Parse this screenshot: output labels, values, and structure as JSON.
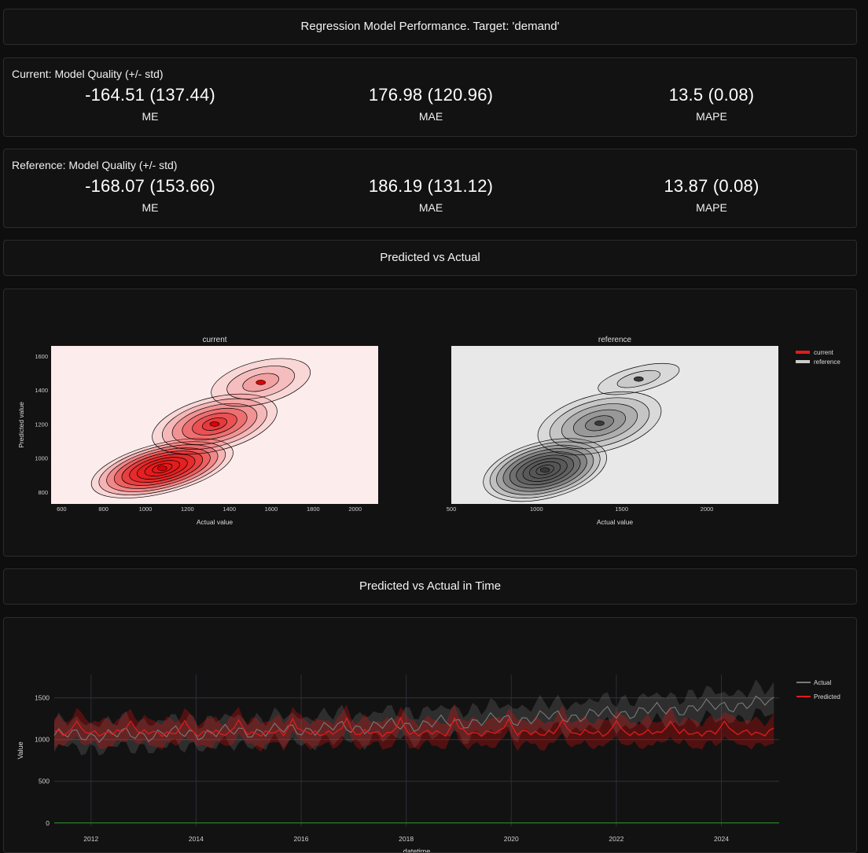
{
  "header": {
    "title": "Regression Model Performance. Target: 'demand'"
  },
  "current_quality": {
    "caption": "Current: Model Quality (+/- std)",
    "metrics": [
      {
        "value": "-164.51 (137.44)",
        "label": "ME"
      },
      {
        "value": "176.98 (120.96)",
        "label": "MAE"
      },
      {
        "value": "13.5 (0.08)",
        "label": "MAPE"
      }
    ]
  },
  "reference_quality": {
    "caption": "Reference: Model Quality (+/- std)",
    "metrics": [
      {
        "value": "-168.07 (153.66)",
        "label": "ME"
      },
      {
        "value": "186.19 (131.12)",
        "label": "MAE"
      },
      {
        "value": "13.87 (0.08)",
        "label": "MAPE"
      }
    ]
  },
  "pred_vs_actual_section": {
    "title": "Predicted vs Actual"
  },
  "pred_vs_actual_in_time_section": {
    "title": "Predicted vs Actual in Time"
  },
  "colors": {
    "current_fill": "#e31a1c",
    "current_bg": "#fdecec",
    "reference_fill": "#555555",
    "reference_bg": "#e8e8e8",
    "actual_line": "#7a7a7a",
    "predicted_line": "#e11b1b",
    "zero_line": "#2ca02c"
  },
  "chart_data": [
    {
      "type": "heatmap",
      "subtype": "2d density contour",
      "titles": [
        "current",
        "reference"
      ],
      "xlabel": "Actual value",
      "ylabel": "Predicted value",
      "legend": {
        "entries": [
          "current",
          "reference"
        ],
        "placement": "top-right"
      },
      "panels": [
        {
          "name": "current",
          "xlim": [
            550,
            2110
          ],
          "ylim": [
            730,
            1660
          ],
          "xticks": [
            600,
            800,
            1000,
            1200,
            1400,
            1600,
            1800,
            2000
          ],
          "yticks": [
            800,
            1000,
            1200,
            1400,
            1600
          ],
          "density_peaks": [
            {
              "x": 1080,
              "y": 940,
              "sx": 160,
              "sy": 65,
              "weight": 1.0
            },
            {
              "x": 1330,
              "y": 1200,
              "sx": 140,
              "sy": 70,
              "weight": 0.7
            },
            {
              "x": 1550,
              "y": 1445,
              "sx": 110,
              "sy": 55,
              "weight": 0.35
            }
          ]
        },
        {
          "name": "reference",
          "xlim": [
            500,
            2420
          ],
          "ylim": [
            730,
            1660
          ],
          "xticks": [
            500,
            1000,
            1500,
            2000
          ],
          "yticks": [
            800,
            1000,
            1200,
            1400,
            1600
          ],
          "density_peaks": [
            {
              "x": 1050,
              "y": 930,
              "sx": 170,
              "sy": 75,
              "weight": 1.0
            },
            {
              "x": 1370,
              "y": 1205,
              "sx": 170,
              "sy": 75,
              "weight": 0.55
            },
            {
              "x": 1600,
              "y": 1465,
              "sx": 110,
              "sy": 30,
              "weight": 0.15
            }
          ]
        }
      ]
    },
    {
      "type": "line",
      "xlabel": "datetime",
      "ylabel": "Value",
      "xlim": [
        2011.3,
        2025.1
      ],
      "ylim": [
        -40,
        1780
      ],
      "xticks": [
        2012,
        2014,
        2016,
        2018,
        2020,
        2022,
        2024
      ],
      "yticks": [
        0,
        500,
        1000,
        1500
      ],
      "legend": {
        "entries": [
          "Actual",
          "Predicted"
        ],
        "placement": "top-right"
      },
      "series": [
        {
          "name": "Actual",
          "start_year": 2011.3,
          "end_year": 2025.0,
          "start_level": 1050,
          "end_level": 1450,
          "band": 160
        },
        {
          "name": "Predicted",
          "start_year": 2011.3,
          "end_year": 2025.0,
          "level": 1080,
          "spike": 1240,
          "band": 150
        }
      ]
    }
  ]
}
